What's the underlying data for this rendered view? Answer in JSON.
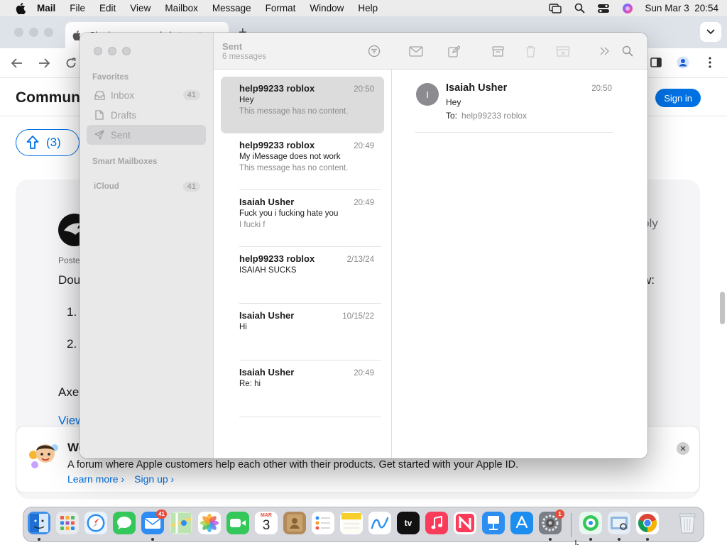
{
  "menubar": {
    "app_name": "Mail",
    "items": [
      "File",
      "Edit",
      "View",
      "Mailbox",
      "Message",
      "Format",
      "Window",
      "Help"
    ],
    "clock": "Sun Mar 3  20:54"
  },
  "browser": {
    "tab_title": "Sharing name and photo not",
    "community_title": "Communi",
    "sign_in": "Sign in",
    "votes": "(3)",
    "posted": "Poste",
    "ply_text": "ply",
    "dou_text": "Dou",
    "w_text": "w:",
    "item1": "1.",
    "item2": "2.",
    "axe_text": "Axe",
    "view_link": "View",
    "banner": {
      "title": "We",
      "text": "A forum where Apple customers help each other with their products. Get started with your Apple ID.",
      "learn_more": "Learn more",
      "sign_up": "Sign up"
    }
  },
  "mail": {
    "sidebar": {
      "favorites_header": "Favorites",
      "items": [
        {
          "label": "Inbox",
          "count": "41"
        },
        {
          "label": "Drafts",
          "count": ""
        },
        {
          "label": "Sent",
          "count": ""
        }
      ],
      "smart_header": "Smart Mailboxes",
      "icloud_label": "iCloud",
      "icloud_count": "41"
    },
    "list": {
      "title": "Sent",
      "subtitle": "6 messages",
      "messages": [
        {
          "from": "help99233 roblox",
          "time": "20:50",
          "subject": "Hey",
          "preview": "This message has no content."
        },
        {
          "from": "help99233 roblox",
          "time": "20:49",
          "subject": "My iMessage does not work",
          "preview": "This message has no content."
        },
        {
          "from": "Isaiah Usher",
          "time": "20:49",
          "subject": "Fuck you i fucking hate you",
          "preview": "I fucki f"
        },
        {
          "from": "help99233 roblox",
          "time": "2/13/24",
          "subject": "ISAIAH SUCKS",
          "preview": ""
        },
        {
          "from": "Isaiah Usher",
          "time": "10/15/22",
          "subject": "Hi",
          "preview": ""
        },
        {
          "from": "Isaiah Usher",
          "time": "20:49",
          "subject": "Re: hi",
          "preview": ""
        }
      ]
    },
    "reader": {
      "avatar_initial": "I",
      "from": "Isaiah Usher",
      "time": "20:50",
      "subject": "Hey",
      "to_label": "To:",
      "to_value": "help99233 roblox"
    }
  },
  "dock": {
    "mail_badge": "41",
    "calendar_month": "MAR",
    "calendar_day": "3",
    "tv_label": "tv",
    "settings_badge": "1"
  },
  "colors": {
    "accent": "#0071e3",
    "badge": "#e74c3c"
  }
}
